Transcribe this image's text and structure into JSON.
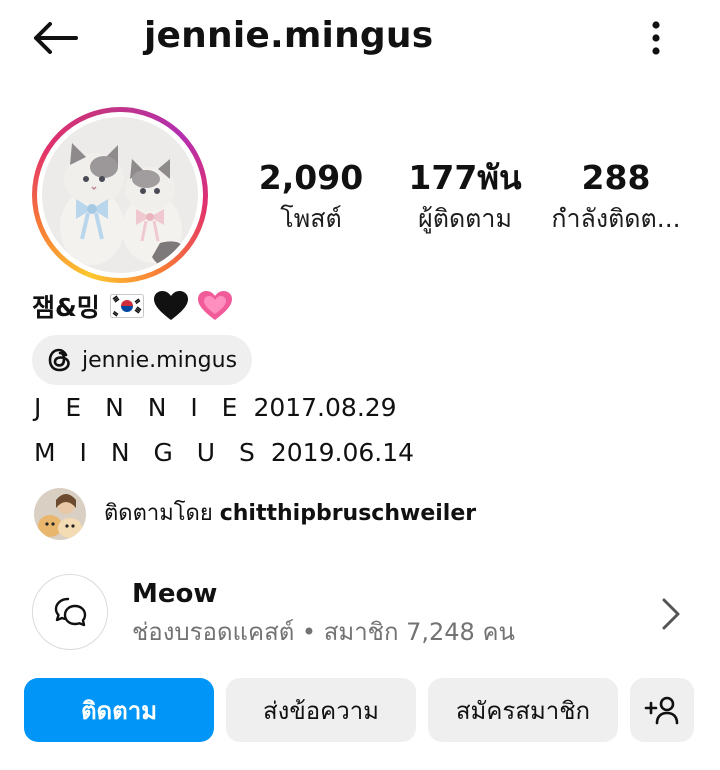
{
  "header": {
    "username": "jennie.mingus",
    "back_icon": "arrow-left-icon",
    "more_icon": "more-vertical-icon"
  },
  "profile": {
    "avatar_desc": "two-cats-illustration",
    "stats": [
      {
        "value": "2,090",
        "label": "โพสต์"
      },
      {
        "value": "177พัน",
        "label": "ผู้ติดตาม"
      },
      {
        "value": "288",
        "label": "กำลังติดต..."
      }
    ],
    "display_name": "잼&밍",
    "name_emojis": [
      "🇰🇷",
      "🖤",
      "💗"
    ],
    "threads_handle": "jennie.mingus",
    "bio_lines": [
      {
        "name": "J E N N I E",
        "date": "2017.08.29"
      },
      {
        "name": "M I N G U S",
        "date": "2019.06.14"
      }
    ],
    "followed_by": {
      "prefix": "ติดตามโดย",
      "user": "chitthipbruschweiler"
    }
  },
  "channel": {
    "title": "Meow",
    "subtitle": "ช่องบรอดแคสต์ • สมาชิก 7,248 คน"
  },
  "actions": {
    "follow": "ติดตาม",
    "message": "ส่งข้อความ",
    "subscribe": "สมัครสมาชิก",
    "add_user_icon": "add-person-icon"
  },
  "colors": {
    "primary_blue": "#0095f6",
    "secondary_bg": "#efefef",
    "muted_text": "#737373"
  }
}
